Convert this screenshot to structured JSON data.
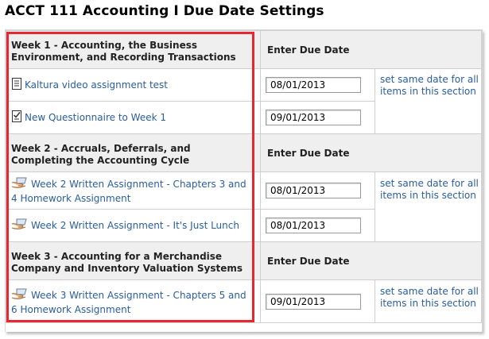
{
  "page_title": "ACCT 111 Accounting I Due Date Settings",
  "due_date_header": "Enter Due Date",
  "same_date_label": "set same date for all items in this section",
  "sections": [
    {
      "title": "Week 1 - Accounting, the Business Environment, and Recording Transactions",
      "items": [
        {
          "label": "Kaltura video assignment test",
          "date": "08/01/2013",
          "icon": "document-icon"
        },
        {
          "label": "New Questionnaire to Week 1",
          "date": "09/01/2013",
          "icon": "questionnaire-icon"
        }
      ]
    },
    {
      "title": "Week 2 - Accruals, Deferrals, and Completing the Accounting Cycle",
      "items": [
        {
          "label": "Week 2 Written Assignment - Chapters 3 and 4 Homework Assignment",
          "date": "08/01/2013",
          "icon": "hand-assignment-icon"
        },
        {
          "label": "Week 2 Written Assignment - It's Just Lunch",
          "date": "08/01/2013",
          "icon": "hand-assignment-icon"
        }
      ]
    },
    {
      "title": "Week 3 - Accounting for a Merchandise Company and Inventory Valuation Systems",
      "items": [
        {
          "label": "Week 3 Written Assignment - Chapters 5 and 6 Homework Assignment",
          "date": "09/01/2013",
          "icon": "hand-assignment-icon"
        }
      ]
    }
  ],
  "colors": {
    "link": "#2a5d9e",
    "highlight": "#e8262f",
    "header_bg": "#efefef"
  }
}
